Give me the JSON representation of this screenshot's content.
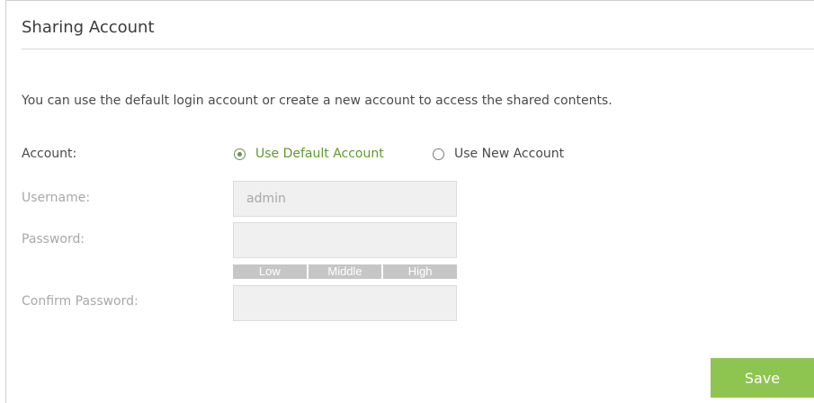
{
  "section": {
    "title": "Sharing Account",
    "description": "You can use the default login account or create a new account to access the shared contents."
  },
  "account": {
    "label": "Account:",
    "options": [
      {
        "label": "Use Default Account",
        "selected": true
      },
      {
        "label": "Use New Account",
        "selected": false
      }
    ]
  },
  "username": {
    "label": "Username:",
    "value": "admin"
  },
  "password": {
    "label": "Password:",
    "value": "",
    "strength_levels": [
      "Low",
      "Middle",
      "High"
    ]
  },
  "confirm_password": {
    "label": "Confirm Password:",
    "value": ""
  },
  "actions": {
    "save_label": "Save"
  },
  "colors": {
    "accent_green": "#8ec550",
    "selected_text_green": "#5e9a2d",
    "disabled_label": "#a8a8a8",
    "disabled_field_bg": "#f0f0f0"
  }
}
